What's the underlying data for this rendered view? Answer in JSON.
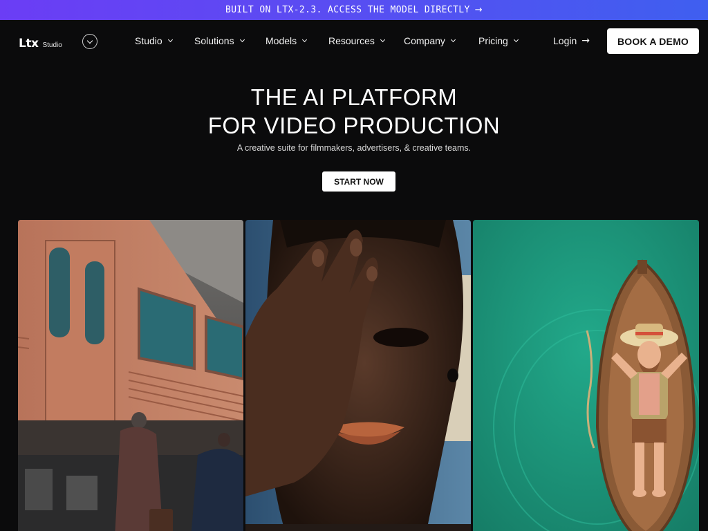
{
  "announcement": {
    "text": "BUILT ON LTX-2.3. ACCESS THE MODEL DIRECTLY",
    "arrow_icon": "arrow-right-icon"
  },
  "nav": {
    "logo_mark": "Ltx",
    "logo_sub": "Studio",
    "items": [
      {
        "label": "Studio"
      },
      {
        "label": "Solutions"
      },
      {
        "label": "Models"
      },
      {
        "label": "Resources"
      },
      {
        "label": "Company"
      },
      {
        "label": "Pricing"
      }
    ],
    "login": "Login",
    "cta": "BOOK A DEMO"
  },
  "hero": {
    "title_line1": "THE AI PLATFORM",
    "title_line2": "FOR VIDEO PRODUCTION",
    "subtitle": "A creative suite for filmmakers, advertisers, & creative teams.",
    "cta": "START NOW"
  },
  "gallery": [
    {
      "subject": "train-platform"
    },
    {
      "subject": "portrait-hand-over-eye"
    },
    {
      "subject": "animated-man-in-rowboat"
    }
  ],
  "colors": {
    "background": "#0b0b0c",
    "banner_start": "#6b3df5",
    "banner_end": "#3f5ff0",
    "button_bg": "#ffffff",
    "water": "#1f9a7f"
  }
}
